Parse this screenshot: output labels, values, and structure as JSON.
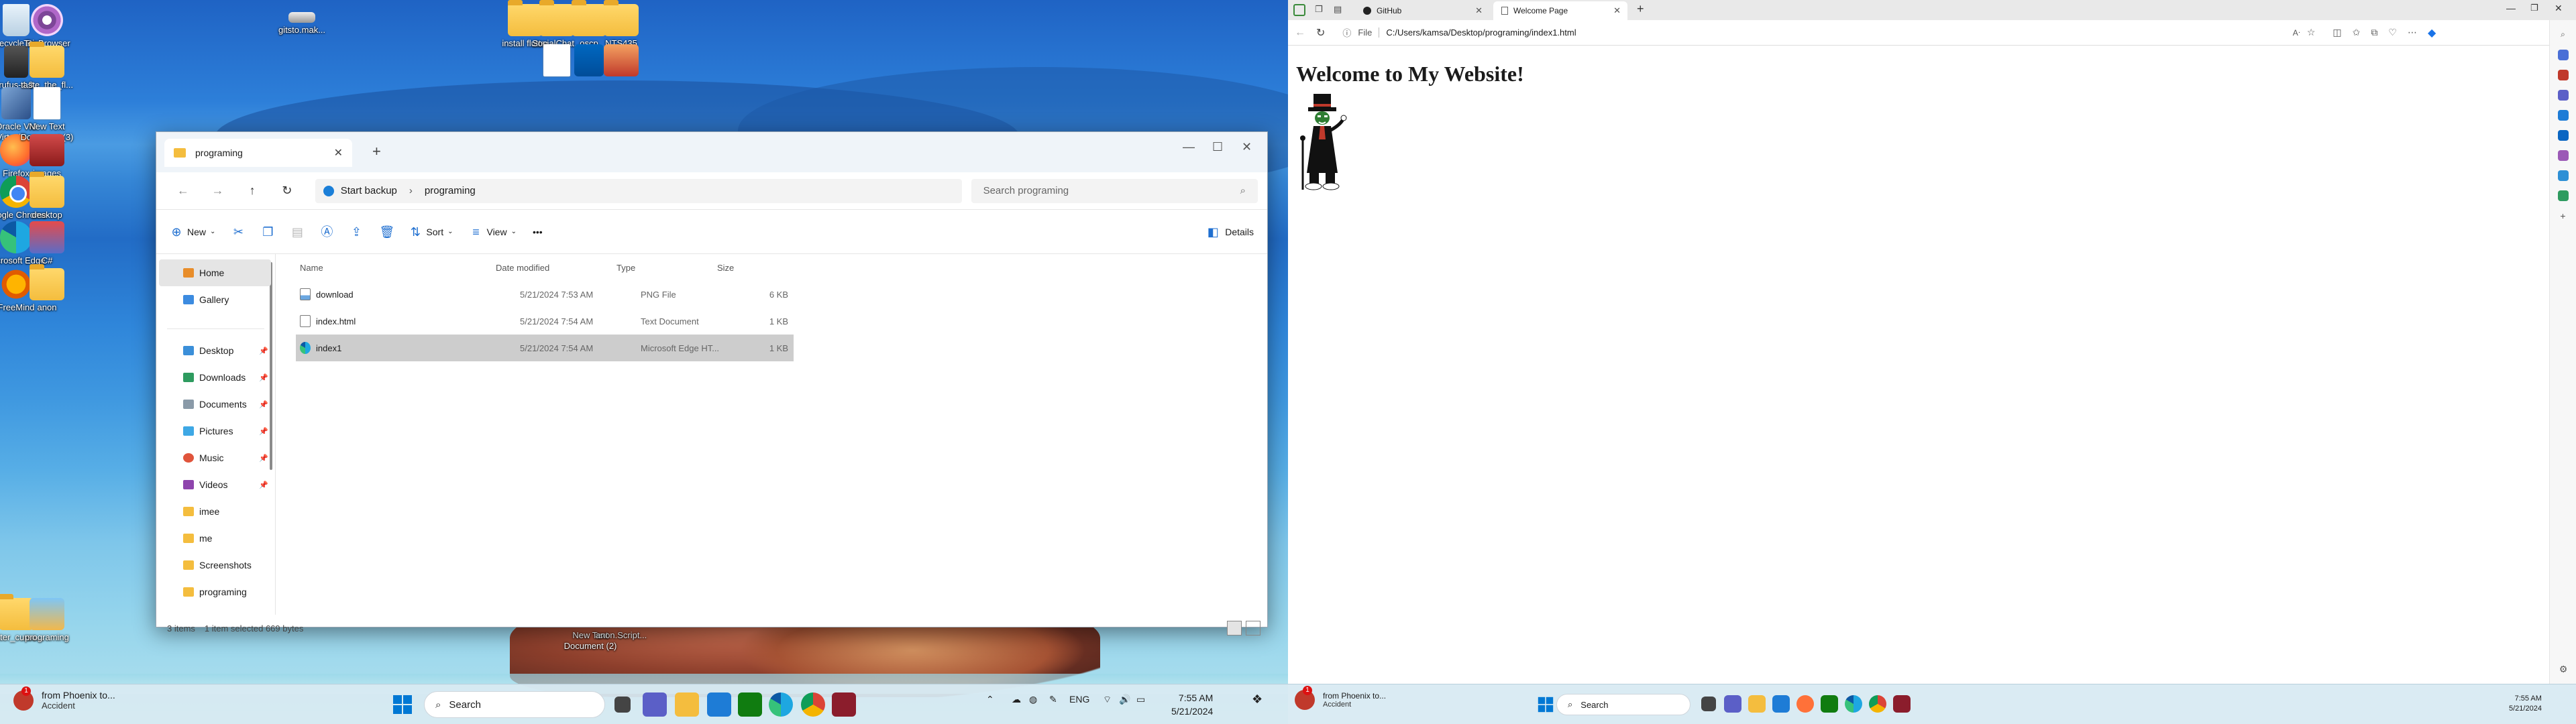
{
  "desktop": {
    "icons": [
      {
        "label": "Recycle Bin"
      },
      {
        "label": "Tor Browser"
      },
      {
        "label": "gitsto.mak..."
      },
      {
        "label": "install flutter"
      },
      {
        "label": "SocialChat..."
      },
      {
        "label": "oscp"
      },
      {
        "label": "NTS435"
      },
      {
        "label": "rufus-4.3"
      },
      {
        "label": "taste_the_fl..."
      },
      {
        "label": "Oracle VM VirtualBox"
      },
      {
        "label": "New Text Document (3)"
      },
      {
        "label": "Firefox"
      },
      {
        "label": "images"
      },
      {
        "label": "Google Chrome"
      },
      {
        "label": "desktop"
      },
      {
        "label": "Microsoft Edge"
      },
      {
        "label": "C#"
      },
      {
        "label": "FreeMind"
      },
      {
        "label": "anon"
      },
      {
        "label": "flutter_curso..."
      },
      {
        "label": "programing"
      },
      {
        "label": "New Text Document (2)"
      },
      {
        "label": "anon.Script..."
      }
    ]
  },
  "explorer": {
    "tab_title": "programing",
    "breadcrumb_start": "Start backup",
    "breadcrumb_current": "programing",
    "search_placeholder": "Search programing",
    "cmd": {
      "new": "New",
      "sort": "Sort",
      "view": "View",
      "more": "•••",
      "details": "Details"
    },
    "sidebar": {
      "home": "Home",
      "gallery": "Gallery",
      "items": [
        "Desktop",
        "Downloads",
        "Documents",
        "Pictures",
        "Music",
        "Videos",
        "imee",
        "me",
        "Screenshots",
        "programing"
      ]
    },
    "columns": {
      "name": "Name",
      "date": "Date modified",
      "type": "Type",
      "size": "Size"
    },
    "files": [
      {
        "name": "download",
        "date": "5/21/2024 7:53 AM",
        "type": "PNG File",
        "size": "6 KB"
      },
      {
        "name": "index.html",
        "date": "5/21/2024 7:54 AM",
        "type": "Text Document",
        "size": "1 KB"
      },
      {
        "name": "index1",
        "date": "5/21/2024 7:54 AM",
        "type": "Microsoft Edge HT...",
        "size": "1 KB"
      }
    ],
    "status": {
      "count": "3 items",
      "selected": "1 item selected  669 bytes"
    }
  },
  "taskbar_left": {
    "notif_title": "from Phoenix to...",
    "notif_sub": "Accident",
    "search": "Search",
    "lang": "ENG",
    "time": "7:55 AM",
    "date": "5/21/2024"
  },
  "browser": {
    "tab1": "GitHub",
    "tab2": "Welcome Page",
    "file_label": "File",
    "url": "C:/Users/kamsa/Desktop/programing/index1.html",
    "heading": "Welcome to My Website!"
  },
  "taskbar_right": {
    "notif_title": "from Phoenix to...",
    "notif_sub": "Accident",
    "search": "Search",
    "time": "7:55 AM",
    "date": "5/21/2024"
  }
}
